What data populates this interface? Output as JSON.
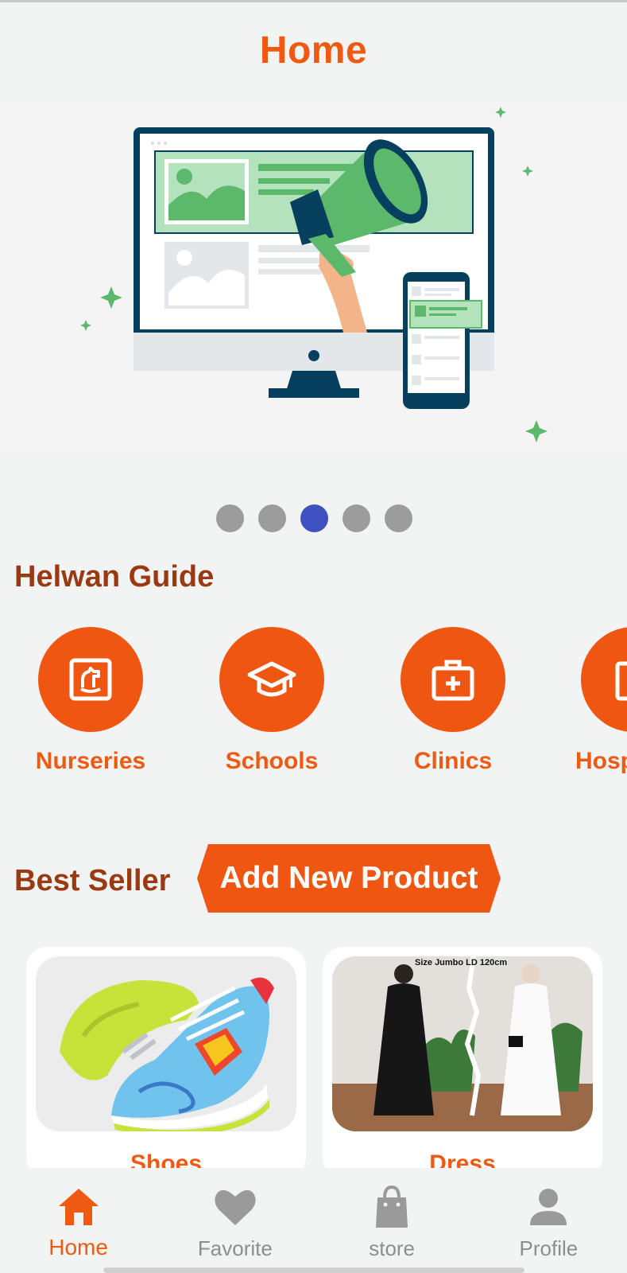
{
  "header": {
    "title": "Home"
  },
  "carousel": {
    "slide_count": 5,
    "active_index": 2
  },
  "guide": {
    "title": "Helwan Guide",
    "items": [
      {
        "label": "Nurseries",
        "icon": "rocking-horse-icon"
      },
      {
        "label": "Schools",
        "icon": "graduation-cap-icon"
      },
      {
        "label": "Clinics",
        "icon": "medical-kit-icon"
      },
      {
        "label": "Hosp",
        "icon": "hospital-icon"
      }
    ]
  },
  "best_seller": {
    "title": "Best Seller",
    "add_button": "Add New Product",
    "products": [
      {
        "name": "Shoes"
      },
      {
        "name": "Dress",
        "image_caption": "Size Jumbo LD 120cm"
      }
    ]
  },
  "bottom_nav": {
    "items": [
      {
        "label": "Home",
        "icon": "home-icon",
        "active": true
      },
      {
        "label": "Favorite",
        "icon": "heart-icon",
        "active": false
      },
      {
        "label": "store",
        "icon": "shopping-bag-icon",
        "active": false
      },
      {
        "label": "Profile",
        "icon": "person-icon",
        "active": false
      }
    ]
  },
  "colors": {
    "accent": "#ef5612",
    "section_title": "#9a3a12",
    "dot_active": "#3f51c0",
    "dot_inactive": "#9c9c9c"
  }
}
